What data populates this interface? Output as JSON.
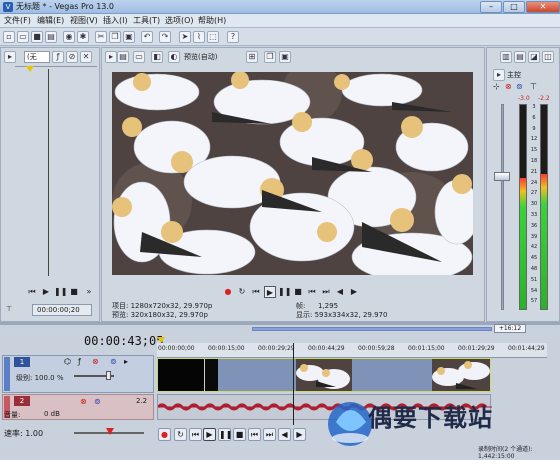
{
  "window": {
    "title": "无标题 * - Vegas Pro 13.0",
    "app_icon": "vegas-logo-icon"
  },
  "menu": {
    "items": [
      "文件(F)",
      "编辑(E)",
      "视图(V)",
      "插入(I)",
      "工具(T)",
      "选项(O)",
      "帮助(H)"
    ]
  },
  "explorer": {
    "dropdown_value": "(无"
  },
  "viewer": {
    "preview_mode": "预览(自动)",
    "timecode_small": "00:00:00;20",
    "project_info": "项目: 1280x720x32, 29.970p",
    "preview_info": "预览: 320x180x32, 29.970p",
    "frame_label": "帧:",
    "frame_value": "1,295",
    "display_info": "显示: 593x334x32, 29.970"
  },
  "mixer": {
    "master_label": "主控",
    "peak_left": "-3.0",
    "peak_right": "-2.2",
    "scale": [
      "3",
      "6",
      "9",
      "12",
      "15",
      "18",
      "21",
      "24",
      "27",
      "30",
      "33",
      "36",
      "39",
      "42",
      "45",
      "48",
      "51",
      "54",
      "57"
    ],
    "level_left": 0.64,
    "level_right": 0.66
  },
  "timeline": {
    "timecode": "00:00:43;05",
    "marker": "+16:12",
    "ruler_ticks": [
      "00:00:00;00",
      "00:00:15;00",
      "00:00:29;29",
      "00:00:44;29",
      "00:00:59;28",
      "00:01:15;00",
      "00:01:29;29",
      "00:01:44;29"
    ],
    "track1": {
      "number": "1",
      "level_label": "级别: 100.0 %"
    },
    "track2": {
      "number": "2",
      "vol_label": "音量:",
      "vol_value": "0 dB",
      "pan_value": "2.2"
    },
    "rate": "速率: 1.00",
    "status": "录制时间(2 个通道): 1,442:15:00"
  },
  "watermark": {
    "text": "偶要下载站"
  }
}
